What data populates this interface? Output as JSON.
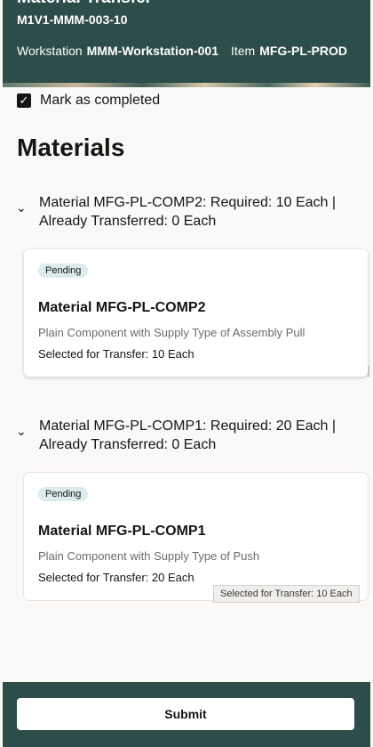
{
  "header": {
    "title": "Material Transfer",
    "subtitle": "M1V1-MMM-003-10",
    "more_icon": "more-icon",
    "workstation_label": "Workstation",
    "workstation_value": "MMM-Workstation-001",
    "item_label": "Item",
    "item_value": "MFG-PL-PROD"
  },
  "completion": {
    "checked": true,
    "label": "Mark as completed"
  },
  "section_title": "Materials",
  "groups": [
    {
      "header_line1": "Material MFG-PL-COMP2: Required: 10 Each |",
      "header_line2": "Already Transferred: 0 Each",
      "card": {
        "status": "Pending",
        "title": "Material MFG-PL-COMP2",
        "description": "Plain Component with Supply Type of Assembly Pull",
        "selected": "Selected for Transfer: 10 Each"
      }
    },
    {
      "header_line1": "Material MFG-PL-COMP1: Required: 20 Each |",
      "header_line2": "Already Transferred: 0 Each",
      "card": {
        "status": "Pending",
        "title": "Material MFG-PL-COMP1",
        "description": "Plain Component with Supply Type of Push",
        "selected": "Selected for Transfer: 20 Each"
      }
    }
  ],
  "tooltip": "Selected for Transfer: 10 Each",
  "footer": {
    "submit_label": "Submit"
  },
  "colors": {
    "header_bg": "#2d4d4a",
    "badge_bg": "#dcebee",
    "page_bg": "#fbf9f8"
  }
}
